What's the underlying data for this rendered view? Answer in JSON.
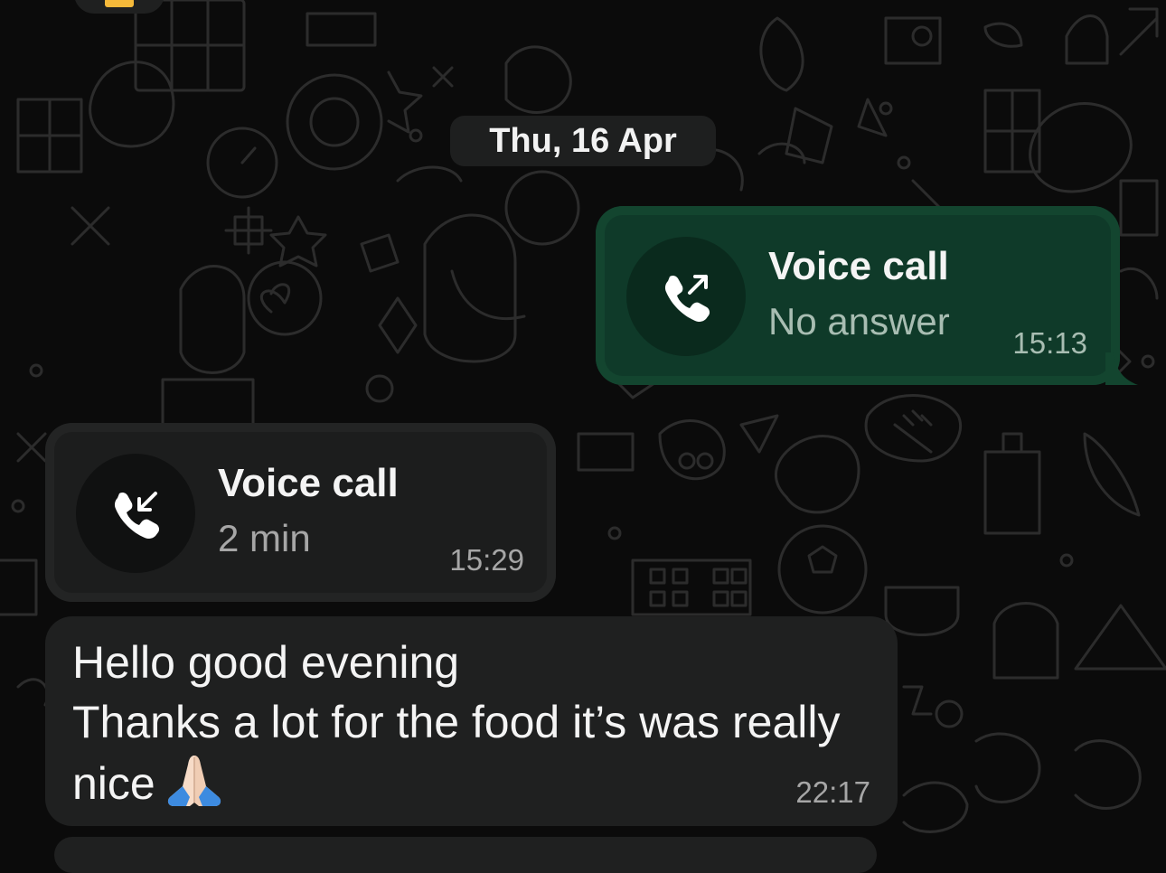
{
  "date_separator": "Thu, 16 Apr",
  "messages": [
    {
      "type": "call",
      "direction": "outgoing",
      "icon": "outgoing-call-icon",
      "title": "Voice call",
      "subtitle": "No answer",
      "time": "15:13"
    },
    {
      "type": "call",
      "direction": "incoming",
      "icon": "incoming-call-icon",
      "title": "Voice call",
      "subtitle": "2 min",
      "time": "15:29"
    },
    {
      "type": "text",
      "direction": "incoming",
      "lines": [
        "Hello good evening",
        "Thanks a lot for the food it’s was really",
        "nice"
      ],
      "emoji": "folded-hands-emoji",
      "time": "22:17"
    }
  ],
  "colors": {
    "background": "#0b0b0b",
    "outgoing_bubble": "#0f3a29",
    "incoming_bubble": "#1f2020",
    "date_chip": "#1e1f1f"
  }
}
